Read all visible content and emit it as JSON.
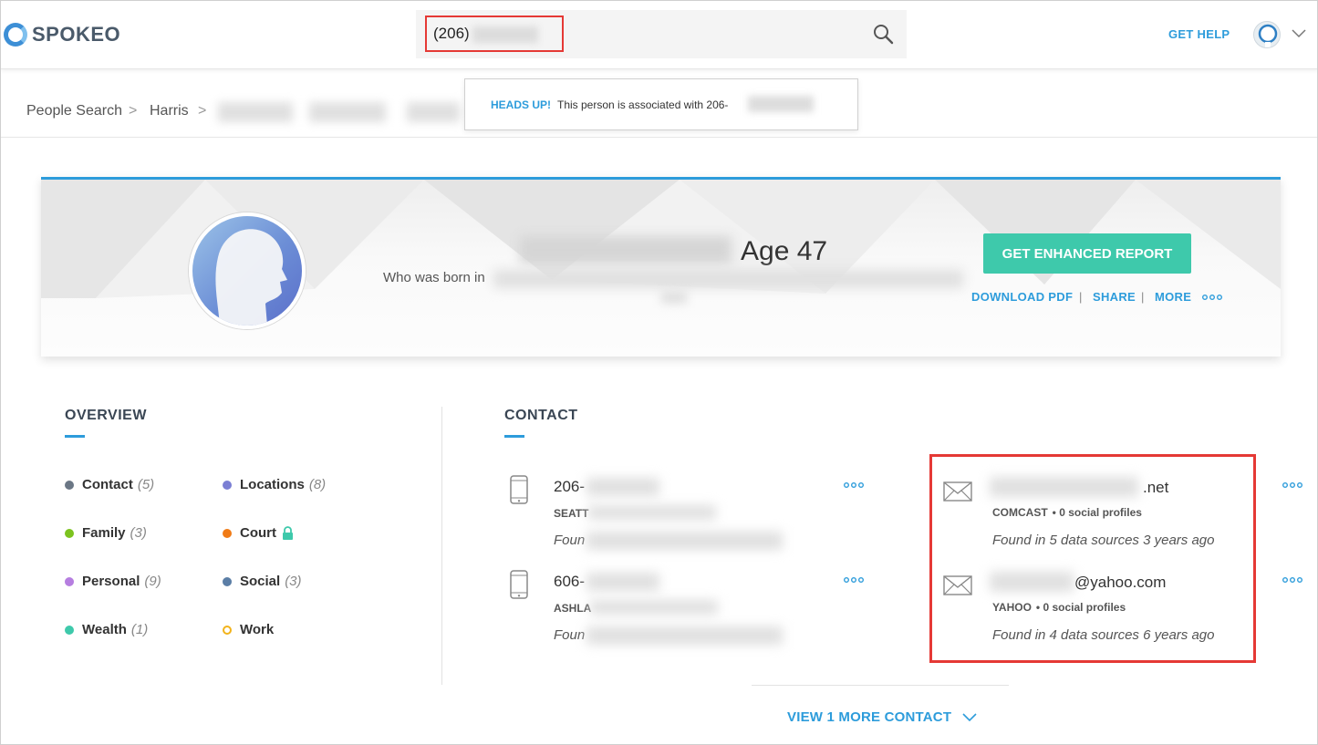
{
  "header": {
    "logo_text": "SPOKEO",
    "search_value": "(206)",
    "get_help": "GET HELP"
  },
  "breadcrumb": {
    "items": [
      "People Search",
      "Harris"
    ],
    "separator": ">"
  },
  "alert": {
    "label": "HEADS UP!",
    "text": "This person is associated with 206-"
  },
  "profile": {
    "age": "Age 47",
    "born_text": "Who was born in",
    "enhanced_button": "GET ENHANCED REPORT",
    "links": [
      "DOWNLOAD PDF",
      "SHARE",
      "MORE"
    ],
    "link_separator": "|"
  },
  "overview": {
    "title": "OVERVIEW",
    "items": [
      {
        "label": "Contact",
        "count": "(5)",
        "color": "#6b7785"
      },
      {
        "label": "Locations",
        "count": "(8)",
        "color": "#7b7fd4"
      },
      {
        "label": "Family",
        "count": "(3)",
        "color": "#7cc31f"
      },
      {
        "label": "Court",
        "count": "",
        "color": "#f07b16"
      },
      {
        "label": "Personal",
        "count": "(9)",
        "color": "#b67ee0"
      },
      {
        "label": "Social",
        "count": "(3)",
        "color": "#5b7ea6"
      },
      {
        "label": "Wealth",
        "count": "(1)",
        "color": "#3ec9ab"
      },
      {
        "label": "Work",
        "count": "",
        "color": "#f2b31b"
      }
    ]
  },
  "contact": {
    "title": "CONTACT",
    "phones": [
      {
        "number": "206-",
        "location": "SEATT",
        "found": "Foun"
      },
      {
        "number": "606-",
        "location": "ASHLA",
        "found": "Foun"
      }
    ],
    "emails": [
      {
        "address": ".net",
        "provider": "COMCAST",
        "social": "• 0 social profiles",
        "found": "Found in 5 data sources 3 years ago"
      },
      {
        "address": "@yahoo.com",
        "provider": "YAHOO",
        "social": "• 0 social profiles",
        "found": "Found in 4 data sources 6 years ago"
      }
    ],
    "view_more": "VIEW 1 MORE CONTACT"
  },
  "colors": {
    "accent": "#2d9cdb",
    "button": "#3ec9ab",
    "highlight": "#e53935"
  }
}
